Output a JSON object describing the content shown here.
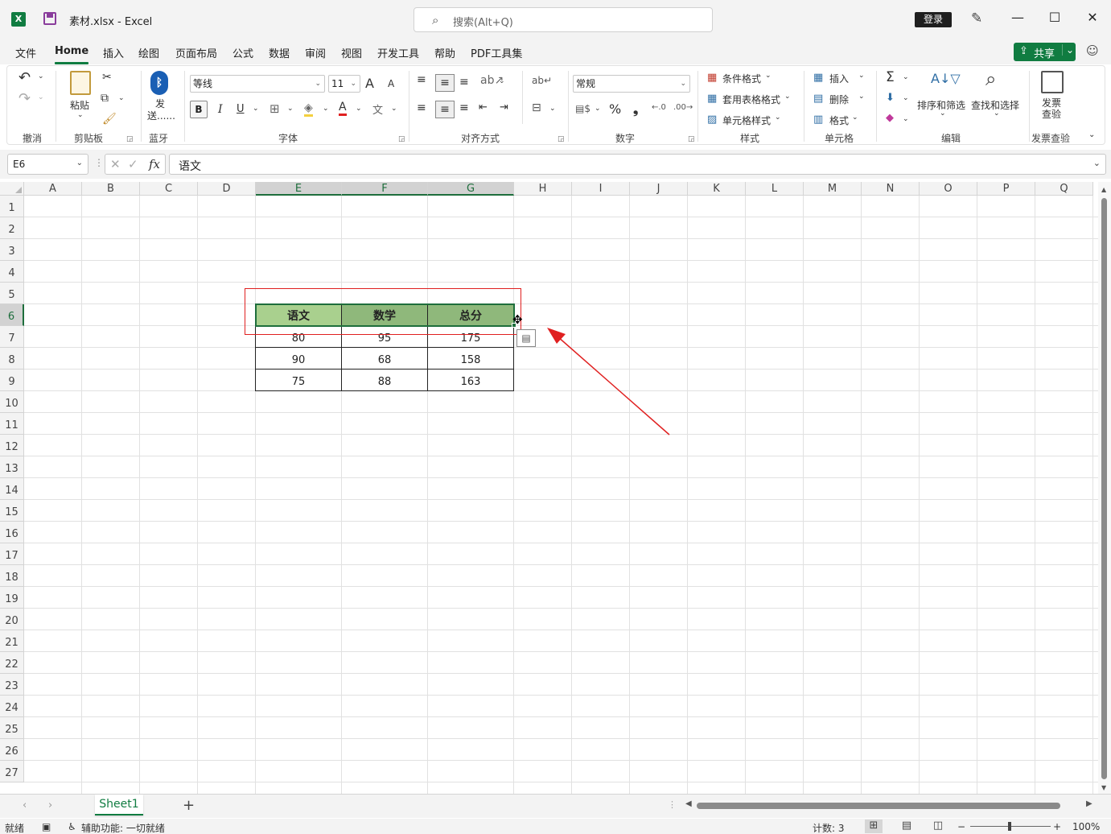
{
  "titlebar": {
    "app_icon": "X",
    "title": "素材.xlsx  -  Excel",
    "search_placeholder": "搜索(Alt+Q)",
    "login_label": "登录",
    "minimize": "—",
    "maximize": "☐",
    "close": "✕"
  },
  "menu": {
    "tabs": [
      "文件",
      "Home",
      "插入",
      "绘图",
      "页面布局",
      "公式",
      "数据",
      "审阅",
      "视图",
      "开发工具",
      "帮助",
      "PDF工具集"
    ],
    "active_tab": "Home",
    "share_label": "共享"
  },
  "ribbon": {
    "undo_group": "撤消",
    "clipboard": {
      "paste": "粘贴",
      "group": "剪贴板"
    },
    "bluetooth": {
      "send": "发送......",
      "group": "蓝牙"
    },
    "font": {
      "name": "等线",
      "size": "11",
      "group": "字体",
      "bold": "B",
      "italic": "I",
      "underline": "U",
      "font_color_letter": "A",
      "grow": "A",
      "shrink": "A"
    },
    "alignment": {
      "group": "对齐方式"
    },
    "number": {
      "format": "常规",
      "group": "数字",
      "percent": "%",
      "comma": "❟"
    },
    "styles": {
      "conditional": "条件格式",
      "table": "套用表格格式",
      "cell": "单元格样式",
      "group": "样式"
    },
    "cells": {
      "insert": "插入",
      "delete": "删除",
      "format": "格式",
      "group": "单元格"
    },
    "editing": {
      "sort": "排序和筛选",
      "find": "查找和选择",
      "group": "编辑"
    },
    "invoice": {
      "check": "发票\n查验",
      "group": "发票查验"
    }
  },
  "formula_bar": {
    "name_box": "E6",
    "fx": "fx",
    "content": "语文"
  },
  "grid": {
    "columns": [
      "A",
      "B",
      "C",
      "D",
      "E",
      "F",
      "G",
      "H",
      "I",
      "J",
      "K",
      "L",
      "M",
      "N",
      "O",
      "P",
      "Q"
    ],
    "rows": [
      "1",
      "2",
      "3",
      "4",
      "5",
      "6",
      "7",
      "8",
      "9",
      "10",
      "11",
      "12",
      "13",
      "14",
      "15",
      "16",
      "17",
      "18",
      "19",
      "20",
      "21",
      "22",
      "23",
      "24",
      "25",
      "26",
      "27"
    ],
    "selected_columns": [
      "E",
      "F",
      "G"
    ],
    "selected_row": "6",
    "table": {
      "headers": [
        "语文",
        "数学",
        "总分"
      ],
      "rows": [
        [
          "80",
          "95",
          "175"
        ],
        [
          "90",
          "68",
          "158"
        ],
        [
          "75",
          "88",
          "163"
        ]
      ],
      "header_colors": [
        "#a9d08e",
        "#8fb87b",
        "#8fb87b"
      ],
      "selection_color": "#1e6e3c"
    }
  },
  "sheets": {
    "tabs": [
      "Sheet1"
    ],
    "active": "Sheet1"
  },
  "status": {
    "ready": "就绪",
    "accessibility": "辅助功能: 一切就绪",
    "count": "计数: 3",
    "zoom": "100%"
  },
  "annotation": {
    "color": "#e02020"
  }
}
